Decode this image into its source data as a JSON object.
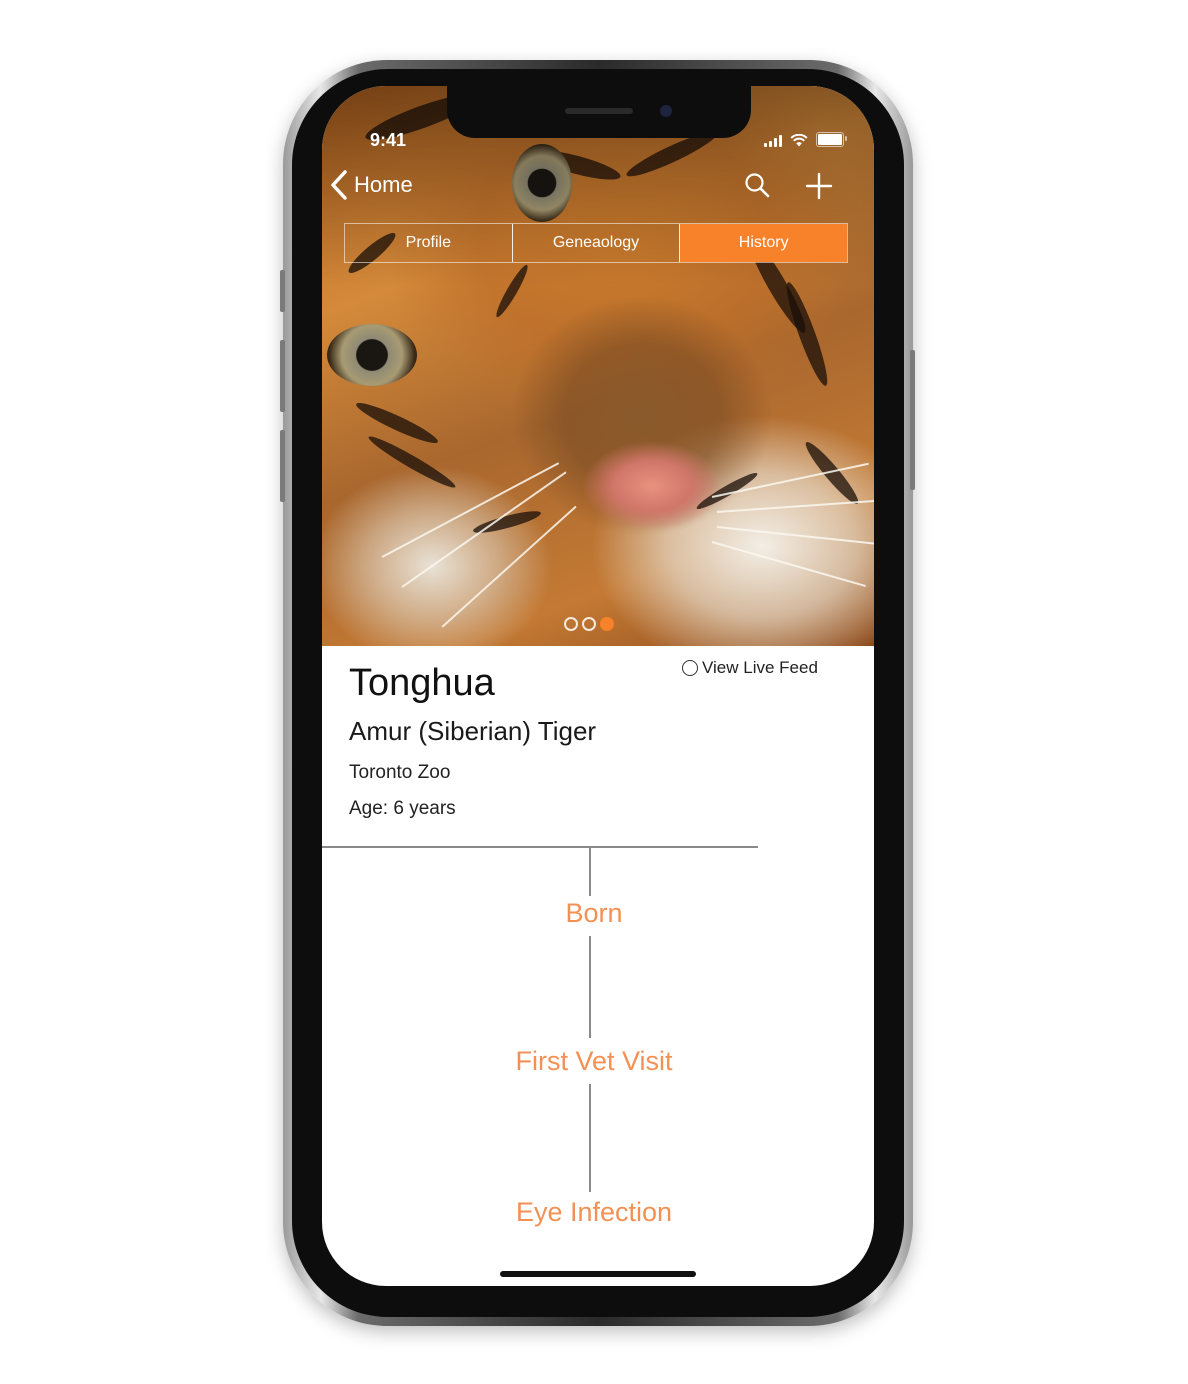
{
  "status_bar": {
    "time": "9:41"
  },
  "nav": {
    "back_label": "Home"
  },
  "tabs": [
    {
      "label": "Profile",
      "active": false
    },
    {
      "label": "Geneaology",
      "active": false
    },
    {
      "label": "History",
      "active": true
    }
  ],
  "carousel": {
    "pages": 3,
    "current_page": 3
  },
  "animal": {
    "name": "Tonghua",
    "species": "Amur (Siberian) Tiger",
    "location": "Toronto Zoo",
    "age": "Age: 6 years"
  },
  "live_feed": {
    "label": "View Live Feed",
    "checked": false
  },
  "timeline": {
    "events": [
      "Born",
      "First Vet Visit",
      "Eye Infection"
    ]
  },
  "colors": {
    "accent": "#f7822a",
    "timeline_text": "#f39054"
  }
}
